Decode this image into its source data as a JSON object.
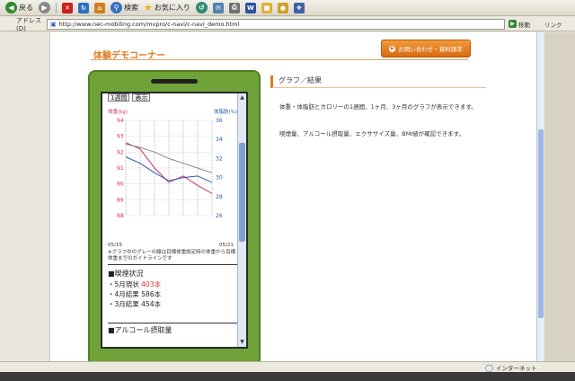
{
  "toolbar": {
    "back_label": "戻る",
    "search_label": "検索",
    "favorites_label": "お気に入り"
  },
  "address": {
    "label": "アドレス(D)",
    "url": "http://www.nec-mobiling.com/mvpro/c-navi/c-navi_demo.html",
    "go_label": "移動",
    "links_label": "リンク"
  },
  "page": {
    "title": "体験デモコーナー",
    "contact_button": "お問い合わせ・資料請求",
    "section_heading": "グラフ／結果",
    "desc1": "体重・体脂肪とカロリーの1週間、1ヶ月、3ヶ月のグラフが表示できます。",
    "desc2": "喫煙量、アルコール摂取量、エクササイズ量、BMI値が確認できます。"
  },
  "phone": {
    "period_select": "1週間",
    "show_button": "表示",
    "note": "※グラフ中のグレーの線は目標体重設定時の体重から目標体重までのガイドラインです",
    "smoke_title": "■喫煙状況",
    "smoke_lines": [
      {
        "label": "・5月現状 ",
        "value": "403本",
        "highlight": true
      },
      {
        "label": "・4月結果 ",
        "value": "586本",
        "highlight": false
      },
      {
        "label": "・3月結果 ",
        "value": "454本",
        "highlight": false
      }
    ],
    "alcohol_title": "■アルコール摂取量"
  },
  "chart_data": {
    "type": "line",
    "title": "",
    "ylabel": "体重(kg)",
    "y2label": "体脂肪(%)",
    "x_start_label": "05/15",
    "x_end_label": "05/21",
    "ylim": [
      88,
      94
    ],
    "y2lim": [
      26,
      36
    ],
    "yticks": [
      "94",
      "93",
      "92",
      "91",
      "90",
      "89",
      "88"
    ],
    "y2ticks": [
      "36",
      "34",
      "32",
      "30",
      "28",
      "26"
    ],
    "x": [
      0,
      1,
      2,
      3,
      4,
      5,
      6
    ],
    "series": [
      {
        "name": "",
        "axis": "left",
        "color": "#d0306a",
        "values": [
          92.6,
          92.2,
          91.0,
          90.1,
          90.5,
          89.9,
          89.4
        ]
      },
      {
        "name": "",
        "axis": "left",
        "color": "#2a5aa8",
        "values": [
          91.7,
          91.3,
          90.7,
          90.2,
          90.4,
          90.5,
          90.1
        ]
      },
      {
        "name": "",
        "axis": "left",
        "color": "#888888",
        "values": [
          92.5,
          92.3,
          92.0,
          91.6,
          91.3,
          91.0,
          90.7
        ]
      }
    ],
    "grid": true
  },
  "status": {
    "zone": "インターネット"
  },
  "colors": {
    "accent": "#e07a1e",
    "phone": "#6fa33a"
  }
}
